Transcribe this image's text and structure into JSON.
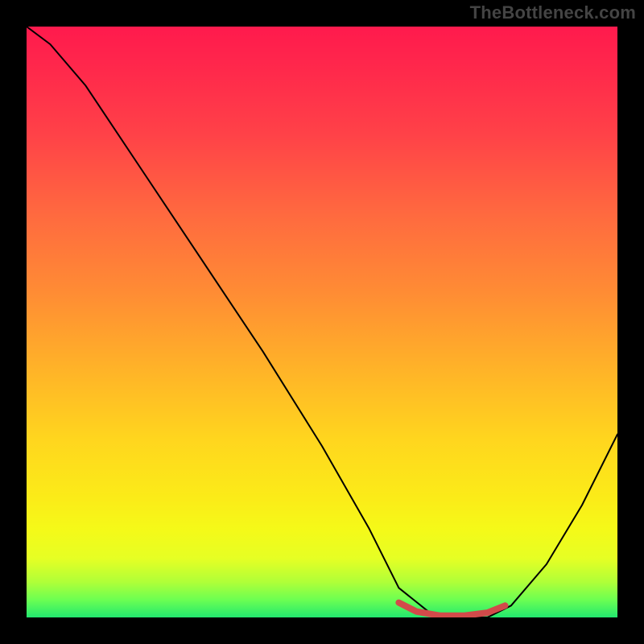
{
  "watermark": "TheBottleneck.com",
  "chart_data": {
    "type": "line",
    "title": "",
    "xlabel": "",
    "ylabel": "",
    "xlim": [
      0,
      100
    ],
    "ylim": [
      0,
      100
    ],
    "grid": false,
    "legend": false,
    "background": "red-yellow-green-vertical-gradient",
    "series": [
      {
        "name": "black-curve",
        "stroke": "#000000",
        "stroke_width": 2,
        "x": [
          0,
          4,
          10,
          20,
          30,
          40,
          50,
          58,
          63,
          68,
          73,
          78,
          82,
          88,
          94,
          100
        ],
        "y": [
          100,
          97,
          90,
          75,
          60,
          45,
          29,
          15,
          5,
          1,
          0,
          0,
          2,
          9,
          19,
          31
        ]
      },
      {
        "name": "red-highlight-segment",
        "stroke": "#d24a4a",
        "stroke_width": 8,
        "x": [
          63,
          66,
          70,
          74,
          78,
          81
        ],
        "y": [
          2.5,
          1.0,
          0.3,
          0.3,
          0.8,
          2.0
        ]
      }
    ],
    "annotations": []
  },
  "colors": {
    "page_background": "#000000",
    "curve_black": "#000000",
    "highlight_red": "#d24a4a",
    "watermark_gray": "#444444"
  }
}
